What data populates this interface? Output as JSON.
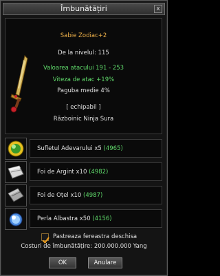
{
  "window": {
    "title": "Îmbunătățiri",
    "close_label": "x"
  },
  "item": {
    "name": "Sabie Zodiac+2",
    "level": "De la nivelul: 115",
    "attack": "Valoarea atacului 191 - 253",
    "attack_speed": "Viteza de atac +19%",
    "average_damage": "Paguba medie 4%",
    "equip": "[ echipabil ]",
    "classes": "Războinic Ninja Sura"
  },
  "materials": [
    {
      "name": "Sufletul Adevarului x5",
      "count": "(4965)",
      "icon": "soul-orb-icon"
    },
    {
      "name": "Foi de Argint x10",
      "count": "(4982)",
      "icon": "silver-sheet-icon"
    },
    {
      "name": "Foi de Oțel x10",
      "count": "(4987)",
      "icon": "steel-sheet-icon"
    },
    {
      "name": "Perla Albastra x50",
      "count": "(4156)",
      "icon": "blue-pearl-icon"
    }
  ],
  "keep_open": {
    "label": "Pastreaza fereastra deschisa",
    "checked": true
  },
  "cost": "Costuri de îmbunătățire: 200.000.000 Yang",
  "buttons": {
    "ok": "OK",
    "cancel": "Anulare"
  },
  "colors": {
    "item_name": "#f0b24a",
    "bonus": "#5fd86a",
    "text": "#e0e0e0"
  }
}
